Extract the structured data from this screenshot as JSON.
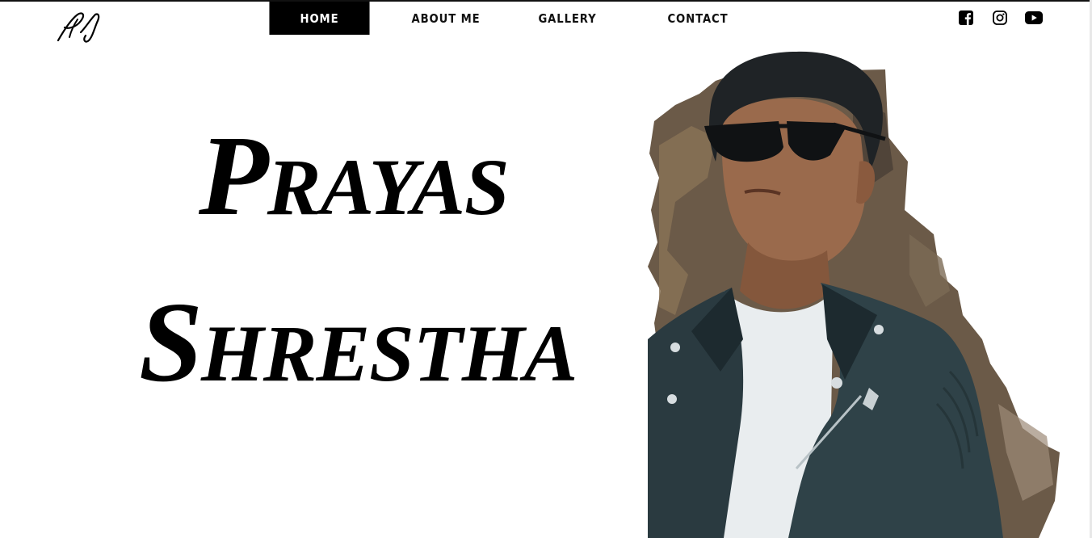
{
  "header": {
    "logo_icon": "signature-logo-icon",
    "nav": [
      {
        "label": "HOME",
        "active": true
      },
      {
        "label": "ABOUT ME",
        "active": false
      },
      {
        "label": "GALLERY",
        "active": false
      },
      {
        "label": "CONTACT",
        "active": false
      }
    ],
    "social": [
      {
        "icon": "facebook-icon"
      },
      {
        "icon": "instagram-icon"
      },
      {
        "icon": "youtube-icon"
      }
    ]
  },
  "hero": {
    "first_name_cap": "P",
    "first_name_rest": "RAYAS",
    "last_name_cap": "S",
    "last_name_rest": "HRESTHA",
    "portrait_icon": "portrait-photo"
  },
  "colors": {
    "text": "#000000",
    "active_nav_bg": "#000000",
    "active_nav_text": "#ffffff",
    "background": "#ffffff"
  }
}
